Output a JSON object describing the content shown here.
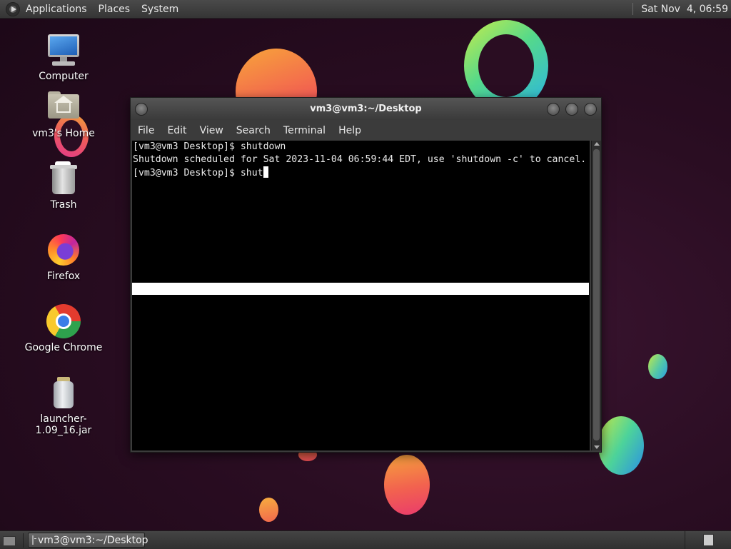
{
  "top_panel": {
    "menus": [
      "Applications",
      "Places",
      "System"
    ],
    "clock": "Sat Nov  4, 06:59"
  },
  "desktop_icons": [
    {
      "label": "Computer",
      "icon": "computer-icon"
    },
    {
      "label": "vm3's Home",
      "icon": "home-folder-icon"
    },
    {
      "label": "Trash",
      "icon": "trash-icon"
    },
    {
      "label": "Firefox",
      "icon": "firefox-icon"
    },
    {
      "label": "Google Chrome",
      "icon": "chrome-icon"
    },
    {
      "label": "launcher-1.09_16.jar",
      "icon": "jar-icon"
    }
  ],
  "terminal": {
    "title": "vm3@vm3:~/Desktop",
    "menu": [
      "File",
      "Edit",
      "View",
      "Search",
      "Terminal",
      "Help"
    ],
    "lines": [
      "[vm3@vm3 Desktop]$ shutdown",
      "Shutdown scheduled for Sat 2023-11-04 06:59:44 EDT, use 'shutdown -c' to cancel.",
      "[vm3@vm3 Desktop]$ shut"
    ]
  },
  "taskbar": {
    "tasks": [
      {
        "label": "vm3@vm3:~/Desktop",
        "icon": "terminal-icon"
      }
    ]
  },
  "colors": {
    "panel_bg": "#3a3a3a",
    "terminal_bg": "#000000",
    "terminal_fg": "#eaeaea",
    "wallpaper_bg": "#2a0d22"
  }
}
